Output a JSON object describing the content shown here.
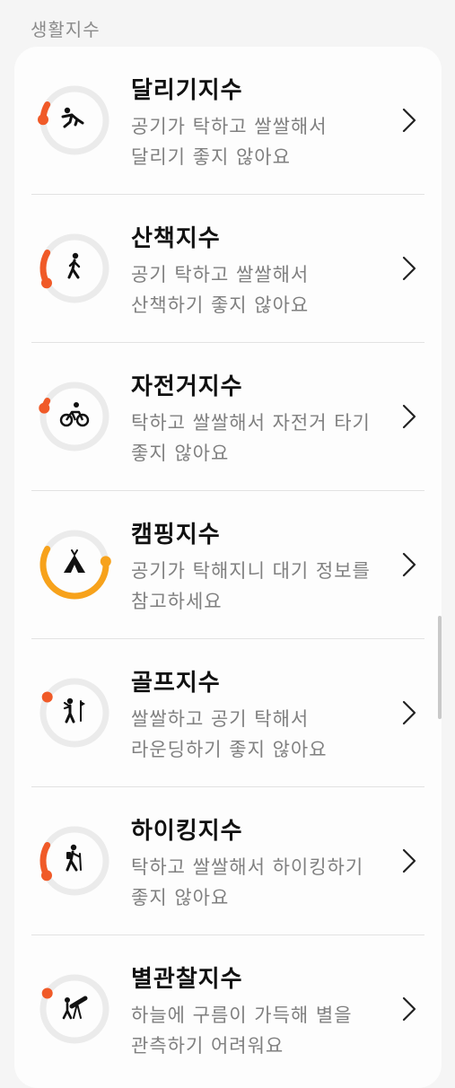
{
  "section_title": "생활지수",
  "colors": {
    "ring_bg": "#ebebeb",
    "bad": "#f05a28",
    "moderate": "#f7a21b"
  },
  "items": [
    {
      "title": "달리기지수",
      "desc": "공기가 탁하고 쌀쌀해서 달리기 좋지 않아요",
      "icon": "running-person-icon",
      "level": 0.08,
      "status": "bad"
    },
    {
      "title": "산책지수",
      "desc": "공기 탁하고 쌀쌀해서 산책하기 좋지 않아요",
      "icon": "walking-person-icon",
      "level": 0.16,
      "status": "bad"
    },
    {
      "title": "자전거지수",
      "desc": "탁하고 쌀쌀해서 자전거 타기 좋지 않아요",
      "icon": "bicycle-icon",
      "level": 0.04,
      "status": "bad"
    },
    {
      "title": "캠핑지수",
      "desc": "공기가 탁해지니 대기 정보를 참고하세요",
      "icon": "tent-icon",
      "level": 0.6,
      "status": "moderate"
    },
    {
      "title": "골프지수",
      "desc": "쌀쌀하고 공기 탁해서 라운딩하기 좋지 않아요",
      "icon": "golf-icon",
      "level": 0.0,
      "status": "bad"
    },
    {
      "title": "하이킹지수",
      "desc": "탁하고 쌀쌀해서 하이킹하기 좋지 않아요",
      "icon": "hiking-icon",
      "level": 0.16,
      "status": "bad"
    },
    {
      "title": "별관찰지수",
      "desc": "하늘에 구름이 가득해 별을 관측하기 어려워요",
      "icon": "telescope-icon",
      "level": 0.0,
      "status": "bad"
    }
  ]
}
